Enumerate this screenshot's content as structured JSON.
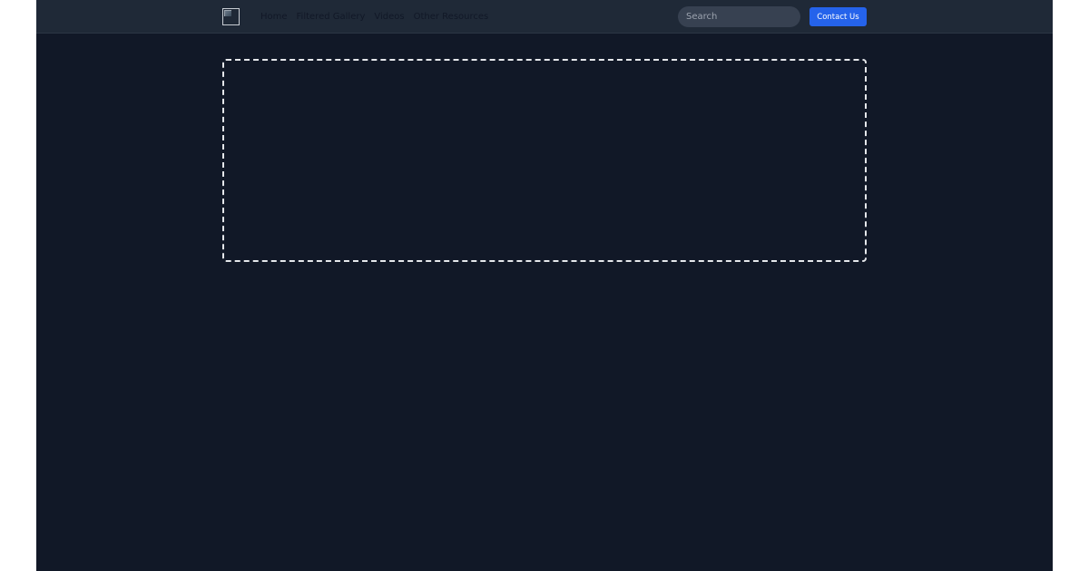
{
  "nav": {
    "logo_icon": "broken-image-icon",
    "links": [
      {
        "label": "Home"
      },
      {
        "label": "Filtered Gallery"
      },
      {
        "label": "Videos"
      },
      {
        "label": "Other Resources"
      }
    ],
    "search": {
      "placeholder": "Search",
      "value": ""
    },
    "contact_label": "Contact Us"
  },
  "colors": {
    "background": "#111827",
    "navbar": "#1f2937",
    "search_bg": "#374151",
    "accent": "#2563eb",
    "nav_text": "#111827",
    "dashed_border": "#e5e7eb"
  }
}
